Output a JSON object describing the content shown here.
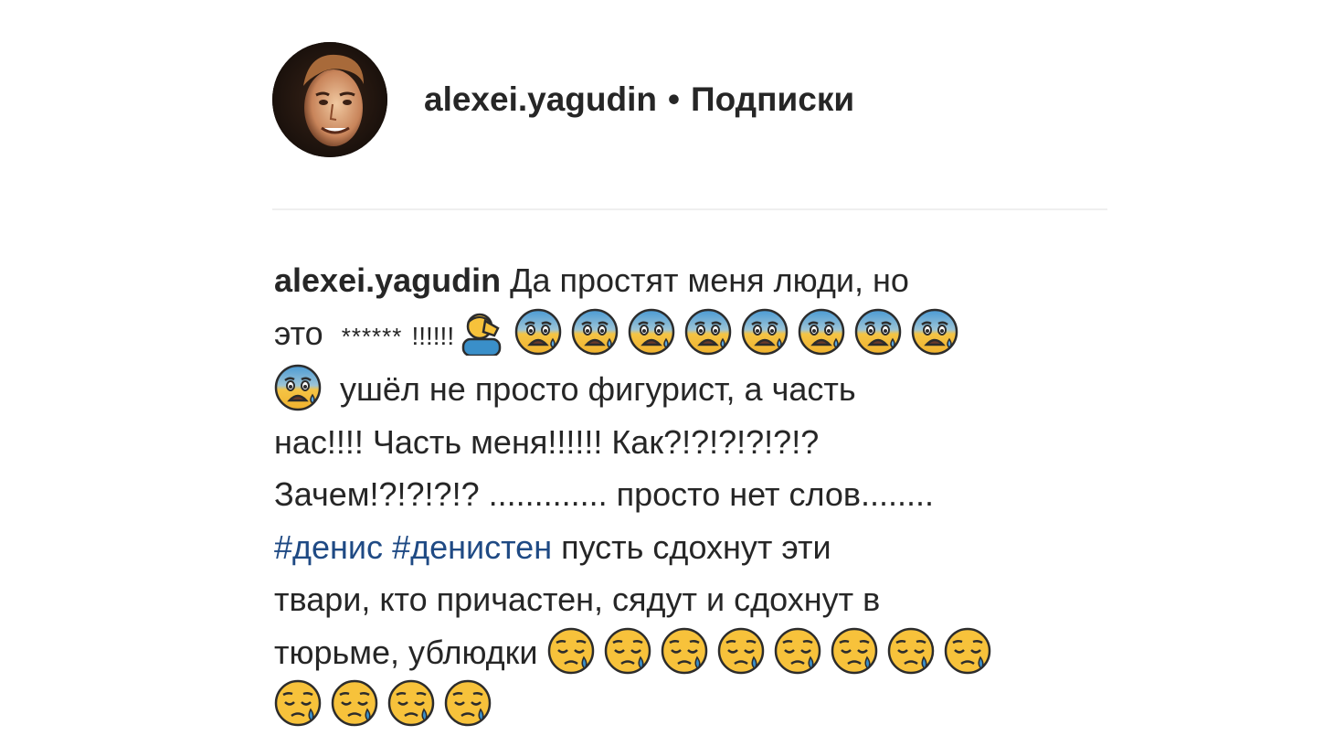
{
  "header": {
    "username": "alexei.yagudin",
    "separator": "•",
    "follow_label": "Подписки"
  },
  "caption": {
    "username": "alexei.yagudin",
    "line1": " Да простят меня люди, но",
    "line2_word": "это",
    "censored": "******",
    "exclamations": "!!!!!!",
    "line3": " ушёл не просто фигурист, а часть",
    "line4": "нас!!!! Часть меня!!!!!! Как?!?!?!?!?!?",
    "line5": "Зачем!?!?!?!? ............. просто нет слов........",
    "hashtag1": "#денис",
    "hashtag2": "#денистен",
    "line6_rest": " пусть сдохнут эти",
    "line7": "твари, кто причастен, сядут и сдохнут в",
    "line8": "тюрьме, ублюдки "
  },
  "icons": {
    "facepalm": "facepalm-emoji-icon",
    "fearful": "fearful-face-emoji-icon",
    "sleepy": "sleepy-face-emoji-icon"
  },
  "colors": {
    "text": "#262626",
    "hashtag": "#1f4a84",
    "divider": "#efefef",
    "emoji_yellow": "#f7c23b",
    "emoji_blue": "#3a8fc9"
  }
}
